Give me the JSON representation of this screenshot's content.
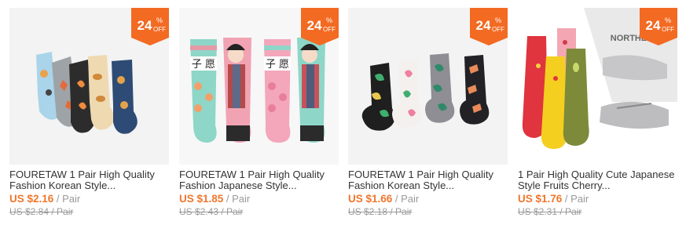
{
  "colors": {
    "accent": "#f36a22",
    "price": "#f0762c",
    "muted": "#999999",
    "text": "#333333"
  },
  "products": [
    {
      "discount_number": "24",
      "discount_pct": "%",
      "discount_off": "OFF",
      "title_line1": "FOURETAW 1 Pair High Quality",
      "title_line2": "Fashion Korean Style...",
      "price": "US $2.16",
      "unit": " / Pair",
      "old_price": "US $2.84",
      "old_unit": " / Pair"
    },
    {
      "discount_number": "24",
      "discount_pct": "%",
      "discount_off": "OFF",
      "title_line1": "FOURETAW 1 Pair High Quality",
      "title_line2": "Fashion Japanese Style...",
      "price": "US $1.85",
      "unit": " / Pair",
      "old_price": "US $2.43",
      "old_unit": " / Pair",
      "sock_text": "子 愿"
    },
    {
      "discount_number": "24",
      "discount_pct": "%",
      "discount_off": "OFF",
      "title_line1": "FOURETAW 1 Pair High Quality",
      "title_line2": "Fashion Korean Style...",
      "price": "US $1.66",
      "unit": " / Pair",
      "old_price": "US $2.18",
      "old_unit": " / Pair"
    },
    {
      "discount_number": "24",
      "discount_pct": "%",
      "discount_off": "OFF",
      "title_line1": "1 Pair High Quality Cute Japanese",
      "title_line2": "Style Fruits Cherry...",
      "price": "US $1.76",
      "unit": " / Pair",
      "old_price": "US $2.31",
      "old_unit": " / Pair",
      "shirt_text": "NORTHEST"
    }
  ]
}
